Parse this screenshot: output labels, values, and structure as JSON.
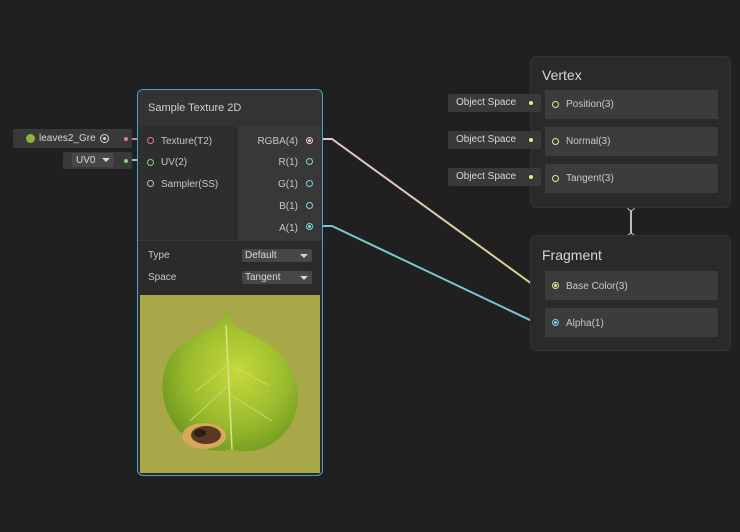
{
  "inputs": {
    "texture_value": "leaves2_Gre",
    "uv_value": "UV0"
  },
  "sample_node": {
    "title": "Sample Texture 2D",
    "in_ports": [
      "Texture(T2)",
      "UV(2)",
      "Sampler(SS)"
    ],
    "out_ports": [
      "RGBA(4)",
      "R(1)",
      "G(1)",
      "B(1)",
      "A(1)"
    ],
    "type_label": "Type",
    "type_value": "Default",
    "space_label": "Space",
    "space_value": "Tangent"
  },
  "vertex": {
    "title": "Vertex",
    "slots": [
      {
        "port": "Position(3)",
        "input": "Object Space"
      },
      {
        "port": "Normal(3)",
        "input": "Object Space"
      },
      {
        "port": "Tangent(3)",
        "input": "Object Space"
      }
    ]
  },
  "fragment": {
    "title": "Fragment",
    "slots": [
      {
        "port": "Base Color(3)"
      },
      {
        "port": "Alpha(1)"
      }
    ]
  },
  "colors": {
    "background": "#202020",
    "selection": "#46a3d6",
    "texture_wire": "#f08c8c",
    "uv_wire": "#9ae07a",
    "vector3_wire": "#f0f08c",
    "vector1_wire": "#7ad6e0",
    "rgba_wire": "#e6c3e6",
    "preview_background": "#a9a94a"
  },
  "icons": [
    "leaf-thumbnail-icon",
    "target-icon",
    "chevron-down-icon"
  ]
}
